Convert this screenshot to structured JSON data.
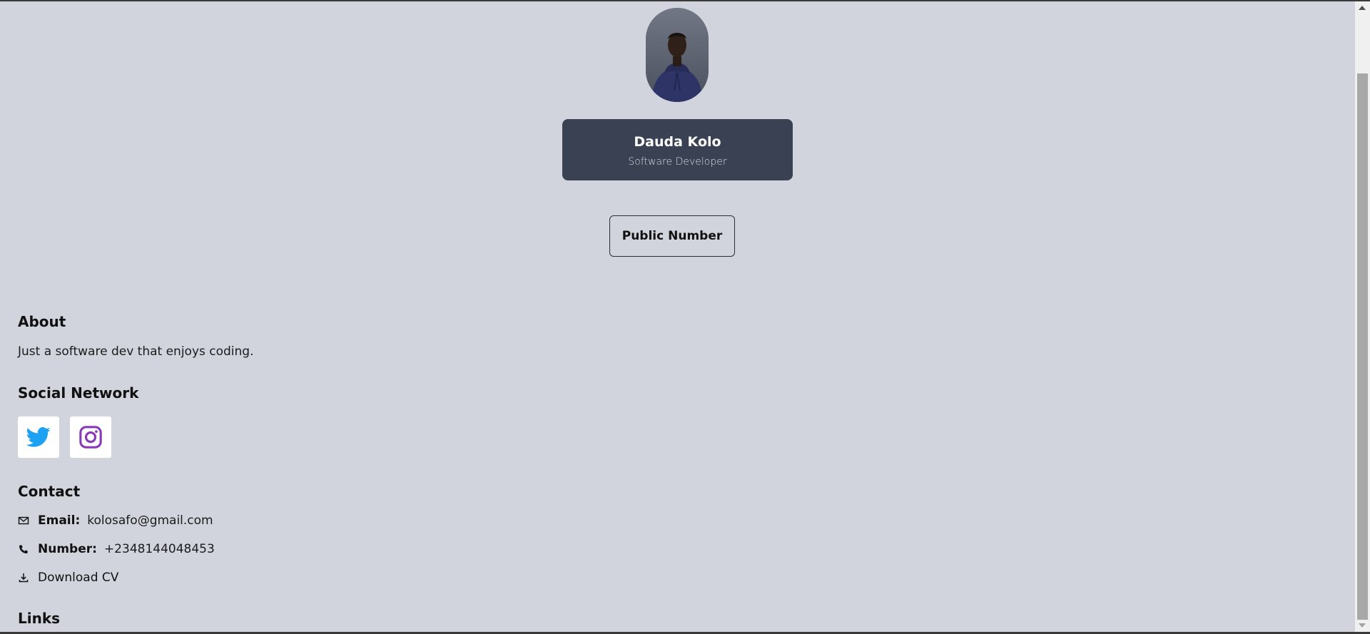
{
  "profile": {
    "name": "Dauda Kolo",
    "role": "Software Developer"
  },
  "actions": {
    "public_number_label": "Public Number"
  },
  "about": {
    "title": "About",
    "text": "Just a software dev that enjoys coding."
  },
  "social": {
    "title": "Social Network",
    "items": [
      {
        "icon": "twitter-icon",
        "color": "#1da1f2"
      },
      {
        "icon": "instagram-icon",
        "color": "#8a3ab9"
      }
    ]
  },
  "contact": {
    "title": "Contact",
    "email_label": "Email:",
    "email_value": "kolosafo@gmail.com",
    "number_label": "Number:",
    "number_value": "+2348144048453",
    "download_label": "Download CV"
  },
  "links": {
    "title": "Links"
  },
  "colors": {
    "background": "#d1d4dc",
    "card": "#394152",
    "twitter": "#1da1f2",
    "instagram": "#8a3ab9"
  }
}
